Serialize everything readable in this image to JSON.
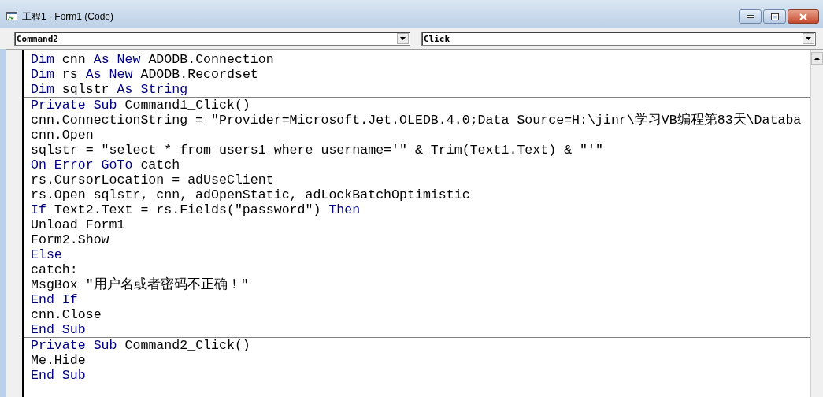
{
  "window": {
    "title": "工程1 - Form1 (Code)"
  },
  "object_dropdown": {
    "value": "Command2"
  },
  "procedure_dropdown": {
    "value": "Click"
  },
  "procedures": [
    {
      "lines": [
        [
          {
            "kind": "keyword",
            "text": "Dim"
          },
          {
            "kind": "plain",
            "text": " cnn "
          },
          {
            "kind": "keyword",
            "text": "As New"
          },
          {
            "kind": "plain",
            "text": " ADODB.Connection"
          }
        ],
        [
          {
            "kind": "keyword",
            "text": "Dim"
          },
          {
            "kind": "plain",
            "text": " rs "
          },
          {
            "kind": "keyword",
            "text": "As New"
          },
          {
            "kind": "plain",
            "text": " ADODB.Recordset"
          }
        ],
        [
          {
            "kind": "keyword",
            "text": "Dim"
          },
          {
            "kind": "plain",
            "text": " sqlstr "
          },
          {
            "kind": "keyword",
            "text": "As String"
          }
        ]
      ]
    },
    {
      "lines": [
        [
          {
            "kind": "keyword",
            "text": "Private Sub"
          },
          {
            "kind": "plain",
            "text": " Command1_Click()"
          }
        ],
        [
          {
            "kind": "plain",
            "text": "cnn.ConnectionString = \"Provider=Microsoft.Jet.OLEDB.4.0;Data Source=H:\\jinr\\学习VB编程第83天\\Databa"
          }
        ],
        [
          {
            "kind": "plain",
            "text": "cnn.Open"
          }
        ],
        [
          {
            "kind": "plain",
            "text": "sqlstr = \"select * from users1 where username='\" & Trim(Text1.Text) & \"'\""
          }
        ],
        [
          {
            "kind": "keyword",
            "text": "On Error GoTo"
          },
          {
            "kind": "plain",
            "text": " catch"
          }
        ],
        [
          {
            "kind": "plain",
            "text": "rs.CursorLocation = adUseClient"
          }
        ],
        [
          {
            "kind": "plain",
            "text": "rs.Open sqlstr, cnn, adOpenStatic, adLockBatchOptimistic"
          }
        ],
        [
          {
            "kind": "keyword",
            "text": "If"
          },
          {
            "kind": "plain",
            "text": " Text2.Text = rs.Fields(\"password\") "
          },
          {
            "kind": "keyword",
            "text": "Then"
          }
        ],
        [
          {
            "kind": "plain",
            "text": "Unload Form1"
          }
        ],
        [
          {
            "kind": "plain",
            "text": "Form2.Show"
          }
        ],
        [
          {
            "kind": "keyword",
            "text": "Else"
          }
        ],
        [
          {
            "kind": "plain",
            "text": "catch:"
          }
        ],
        [
          {
            "kind": "plain",
            "text": "MsgBox \"用户名或者密码不正确！\""
          }
        ],
        [
          {
            "kind": "keyword",
            "text": "End If"
          }
        ],
        [
          {
            "kind": "plain",
            "text": "cnn.Close"
          }
        ],
        [
          {
            "kind": "keyword",
            "text": "End Sub"
          }
        ]
      ]
    },
    {
      "lines": [
        [
          {
            "kind": "keyword",
            "text": "Private Sub"
          },
          {
            "kind": "plain",
            "text": " Command2_Click()"
          }
        ],
        [
          {
            "kind": "plain",
            "text": "Me.Hide"
          }
        ],
        [
          {
            "kind": "keyword",
            "text": "End Sub"
          }
        ]
      ]
    }
  ]
}
